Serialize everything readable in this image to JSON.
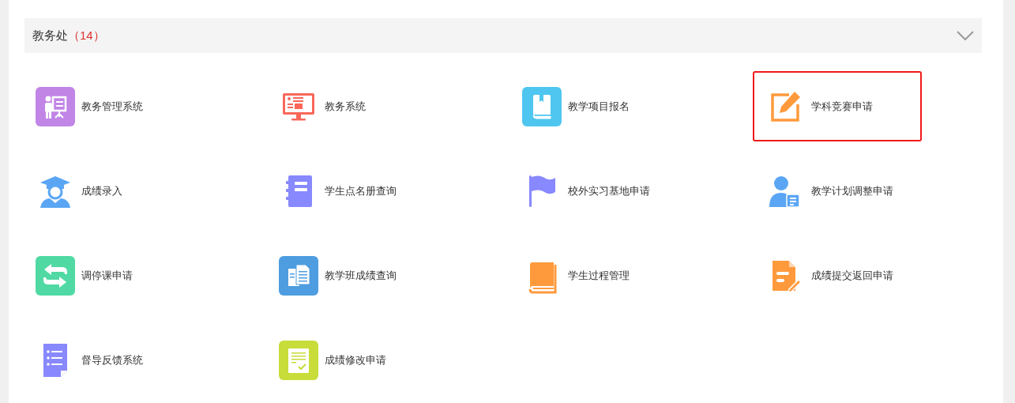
{
  "section": {
    "title": "教务处",
    "count": "（14）"
  },
  "apps": [
    {
      "label": "教务管理系统",
      "kind": "presenter",
      "highlighted": false
    },
    {
      "label": "教务系统",
      "kind": "monitor",
      "highlighted": false
    },
    {
      "label": "教学项目报名",
      "kind": "book",
      "highlighted": false
    },
    {
      "label": "学科竞赛申请",
      "kind": "edit",
      "highlighted": true
    },
    {
      "label": "成绩录入",
      "kind": "graduate",
      "highlighted": false
    },
    {
      "label": "学生点名册查询",
      "kind": "notebook",
      "highlighted": false
    },
    {
      "label": "校外实习基地申请",
      "kind": "flag",
      "highlighted": false
    },
    {
      "label": "教学计划调整申请",
      "kind": "user-doc",
      "highlighted": false
    },
    {
      "label": "调停课申请",
      "kind": "swap",
      "highlighted": false
    },
    {
      "label": "教学班成绩查询",
      "kind": "docs",
      "highlighted": false
    },
    {
      "label": "学生过程管理",
      "kind": "orange-book",
      "highlighted": false
    },
    {
      "label": "成绩提交返回申请",
      "kind": "doc-pen",
      "highlighted": false
    },
    {
      "label": "督导反馈系统",
      "kind": "list",
      "highlighted": false
    },
    {
      "label": "成绩修改申请",
      "kind": "checklist",
      "highlighted": false
    }
  ]
}
